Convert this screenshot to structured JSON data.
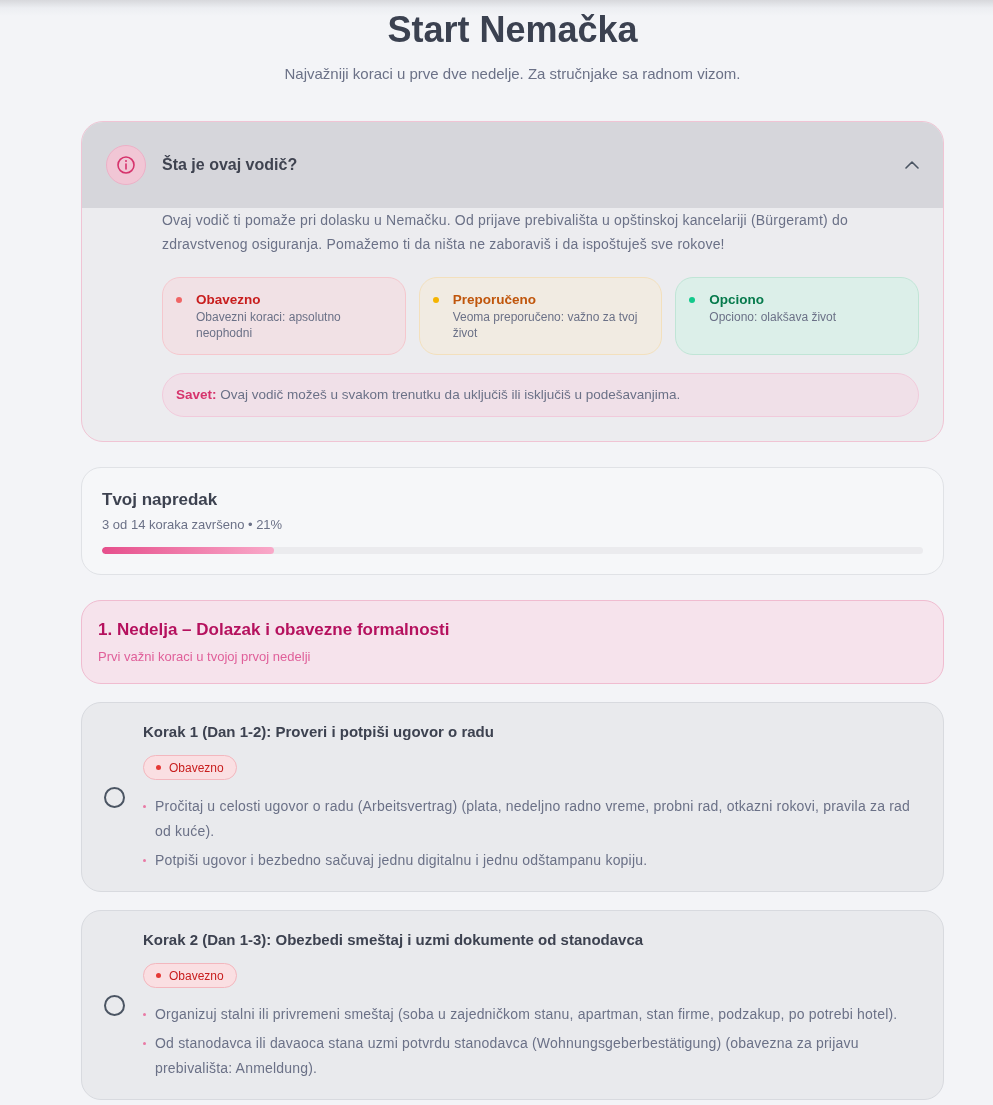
{
  "header": {
    "title": "Start Nemačka",
    "subtitle": "Najvažniji koraci u prve dve nedelje. Za stručnjake sa radnom vizom."
  },
  "guide": {
    "title": "Šta je ovaj vodič?",
    "expanded": true,
    "description": "Ovaj vodič ti pomaže pri dolasku u Nemačku. Od prijave prebivališta u opštinskoj kancelariji (Bürgeramt) do zdravstvenog osiguranja. Pomažemo ti da ništa ne zaboraviš i da ispoštuješ sve rokove!",
    "legend": [
      {
        "kind": "required",
        "color": "#f06565",
        "label": "Obavezno",
        "description": "Obavezni koraci: apsolutno neophodni"
      },
      {
        "kind": "recommended",
        "color": "#f5b400",
        "label": "Preporučeno",
        "description": "Veoma preporučeno: važno za tvoj život"
      },
      {
        "kind": "optional",
        "color": "#12c98b",
        "label": "Opciono",
        "description": "Opciono: olakšava život"
      }
    ],
    "tip": "**Savet:** Ovaj vodič možeš u svakom trenutku da uključiš ili isključiš u podešavanjima."
  },
  "progress": {
    "title": "Tvoj napredak",
    "summary": "3 od 14 koraka završeno • 21%",
    "level": 0.21
  },
  "weeks": [
    {
      "title": "1. Nedelja – Dolazak i obavezne formalnosti",
      "subtitle": "Prvi važni koraci u tvojoj prvoj nedelji",
      "steps": [
        {
          "title": "Korak 1 (Dan 1-2): Proveri i potpiši ugovor o radu",
          "checked": false,
          "badge": {
            "kind": "required",
            "label": "Obavezno"
          },
          "bullets": [
            "Pročitaj u celosti ugovor o radu (Arbeitsvertrag) (plata, nedeljno radno vreme, probni rad, otkazni rokovi, pravila za rad od kuće).",
            "Potpiši ugovor i bezbedno sačuvaj jednu digitalnu i jednu odštampanu kopiju."
          ]
        },
        {
          "title": "Korak 2 (Dan 1-3): Obezbedi smeštaj i uzmi dokumente od stanodavca",
          "checked": false,
          "badge": {
            "kind": "required",
            "label": "Obavezno"
          },
          "bullets": [
            "Organizuj stalni ili privremeni smeštaj (soba u zajedničkom stanu, apartman, stan firme, podzakup, po potrebi hotel).",
            "Od stanodavca ili davaoca stana uzmi potvrdu stanodavca (Wohnungsgeberbestätigung) (obavezna za prijavu prebivališta: Anmeldung)."
          ]
        }
      ]
    }
  ]
}
